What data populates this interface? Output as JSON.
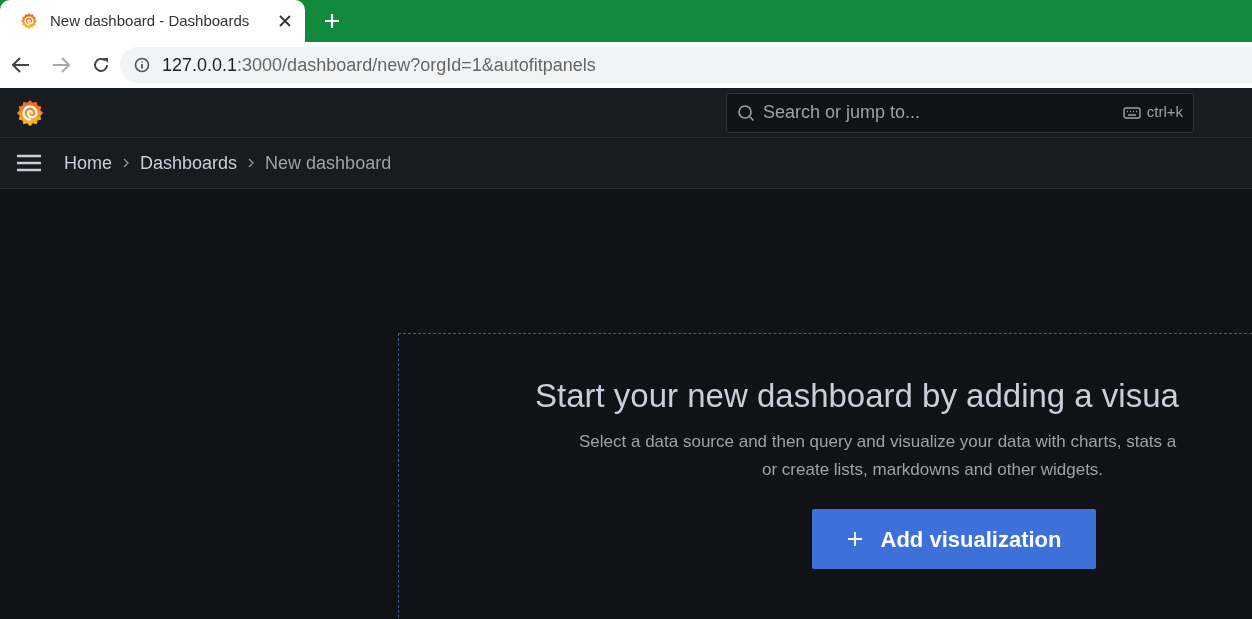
{
  "browser": {
    "tab": {
      "title": "New dashboard - Dashboards",
      "selected": true
    },
    "address": {
      "host": "127.0.0.1",
      "path": ":3000/dashboard/new?orgId=1&autofitpanels"
    }
  },
  "topbar": {
    "search": {
      "placeholder": "Search or jump to...",
      "shortcut": "ctrl+k"
    }
  },
  "breadcrumbs": [
    {
      "label": "Home",
      "current": false
    },
    {
      "label": "Dashboards",
      "current": false
    },
    {
      "label": "New dashboard",
      "current": true
    }
  ],
  "empty_panel": {
    "title": "Start your new dashboard by adding a visua",
    "description_lines": [
      "Select a data source and then query and visualize your data with charts, stats a",
      "or create lists, markdowns and other widgets."
    ],
    "button": "Add visualization"
  }
}
